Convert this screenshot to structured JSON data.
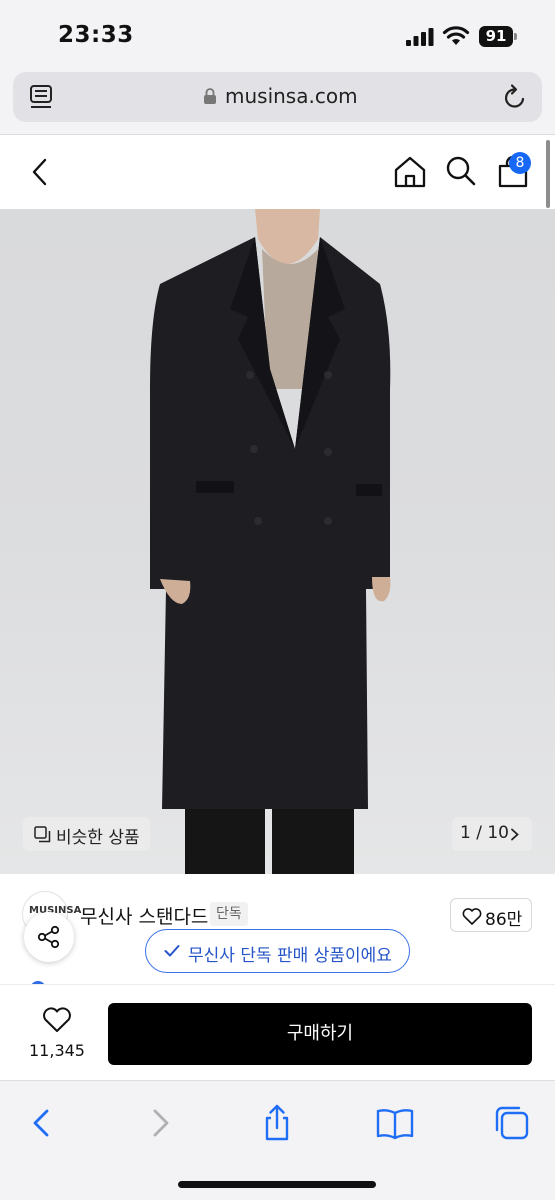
{
  "status_bar": {
    "time": "23:33",
    "battery": "91"
  },
  "browser": {
    "url": "musinsa.com"
  },
  "header": {
    "cart_count": "8"
  },
  "gallery": {
    "similar_label": "비슷한 상품",
    "pager_label": "1 / 10"
  },
  "brand": {
    "logo_text": "MUSINSA",
    "name": "무신사 스탠다드",
    "tag": "단독",
    "likes": "86만",
    "toast": "무신사 단독 판매 상품이에요"
  },
  "purchase": {
    "wish_count": "11,345",
    "buy_label": "구매하기"
  },
  "colors": {
    "accent": "#1769f5",
    "toast_blue": "#2655c8",
    "buy_button": "#000000"
  }
}
